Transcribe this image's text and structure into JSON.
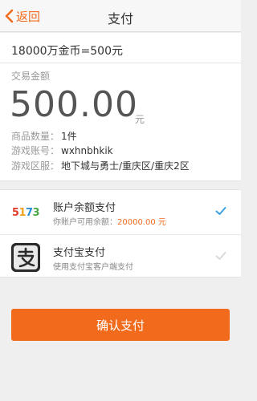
{
  "header": {
    "back_label": "返回",
    "title": "支付"
  },
  "order": {
    "product": "18000万金币=500元",
    "amount_label": "交易金额",
    "amount": "500.00",
    "amount_unit": "元",
    "quantity_label": "商品数量：",
    "quantity_value": "1件",
    "account_label": "游戏账号：",
    "account_value": "wxhnbhkik",
    "server_label": "游戏区服：",
    "server_value": "地下城与勇士/重庆区/重庆2区"
  },
  "payment_methods": [
    {
      "title": "账户余额支付",
      "sub_prefix": "你账户可用余额：",
      "sub_highlight": "20000.00 元",
      "selected": true,
      "icon": "logo-5173"
    },
    {
      "title": "支付宝支付",
      "sub": "使用支付宝客户端支付",
      "selected": false,
      "icon": "alipay-logo"
    }
  ],
  "logo_5173_text": [
    "5",
    "1",
    "7",
    "3"
  ],
  "confirm_label": "确认支付",
  "colors": {
    "accent": "#f26b1d",
    "check_active": "#3aa0e0",
    "check_inactive": "#d9d9d9"
  }
}
